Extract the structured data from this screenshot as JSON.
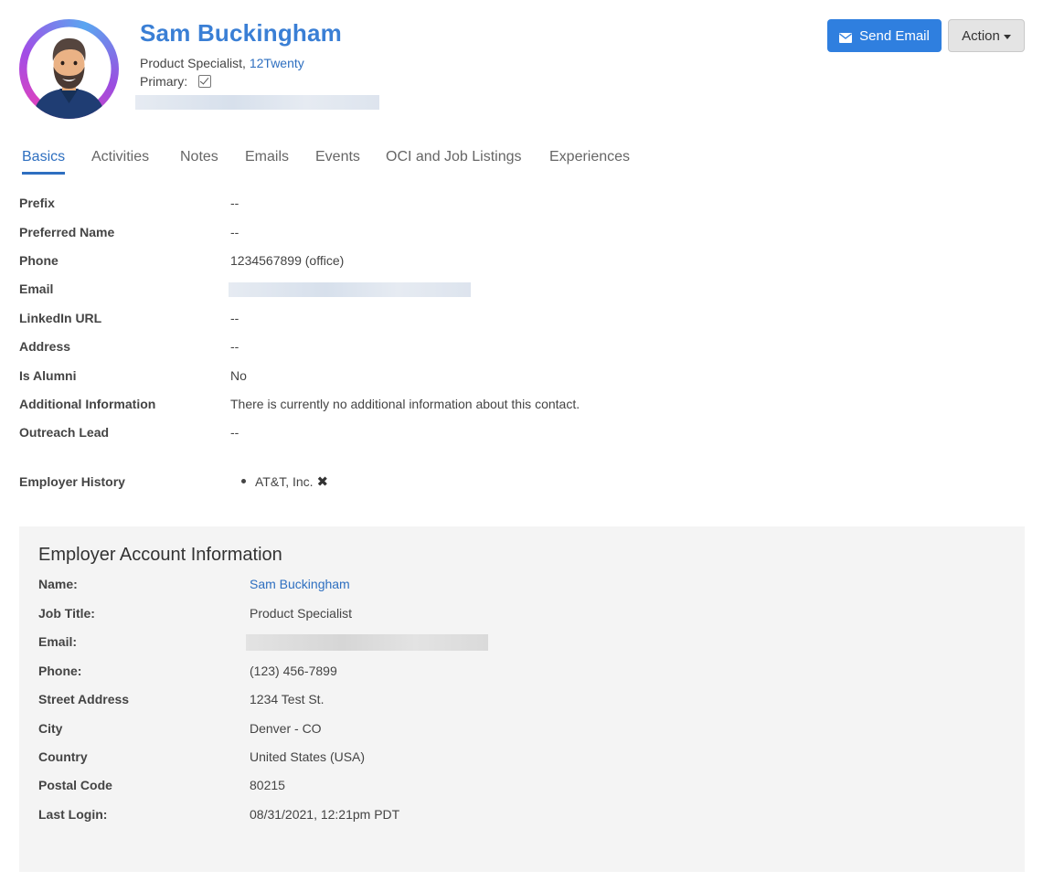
{
  "header": {
    "name": "Sam Buckingham",
    "job_title": "Product Specialist,",
    "company": "12Twenty",
    "primary_label": "Primary:",
    "primary_checked": true
  },
  "actions": {
    "send_email_label": "Send Email",
    "action_label": "Action"
  },
  "tabs": [
    {
      "label": "Basics",
      "active": true
    },
    {
      "label": "Activities",
      "active": false
    },
    {
      "label": "Notes",
      "active": false
    },
    {
      "label": "Emails",
      "active": false
    },
    {
      "label": "Events",
      "active": false
    },
    {
      "label": "OCI and Job Listings",
      "active": false
    },
    {
      "label": "Experiences",
      "active": false
    }
  ],
  "basics": [
    {
      "label": "Prefix",
      "value": "--"
    },
    {
      "label": "Preferred Name",
      "value": "--"
    },
    {
      "label": "Phone",
      "value": "1234567899 (office)"
    },
    {
      "label": "Email",
      "value": ""
    },
    {
      "label": "LinkedIn URL",
      "value": "--"
    },
    {
      "label": "Address",
      "value": "--"
    },
    {
      "label": "Is Alumni",
      "value": "No"
    },
    {
      "label": "Additional Information",
      "value": "There is currently no additional information about this contact."
    },
    {
      "label": "Outreach Lead",
      "value": "--"
    }
  ],
  "employer_history": {
    "label": "Employer History",
    "items": [
      "AT&T, Inc."
    ]
  },
  "employer_account": {
    "title": "Employer Account Information",
    "rows": [
      {
        "label": "Name:",
        "value": "Sam Buckingham"
      },
      {
        "label": "Job Title:",
        "value": "Product Specialist"
      },
      {
        "label": "Email:",
        "value": ""
      },
      {
        "label": "Phone:",
        "value": "(123) 456-7899"
      },
      {
        "label": "Street Address",
        "value": "1234 Test St."
      },
      {
        "label": "City",
        "value": "Denver - CO"
      },
      {
        "label": "Country",
        "value": "United States (USA)"
      },
      {
        "label": "Postal Code",
        "value": "80215"
      },
      {
        "label": "Last Login:",
        "value": "08/31/2021, 12:21pm PDT"
      }
    ]
  },
  "colors": {
    "accent": "#2e6fc0",
    "primary_button": "#2f7fdf",
    "panel_bg": "#f4f4f4"
  },
  "icons": [
    "envelope-icon",
    "caret-down-icon",
    "checkbox-checked-icon",
    "remove-x-icon"
  ]
}
